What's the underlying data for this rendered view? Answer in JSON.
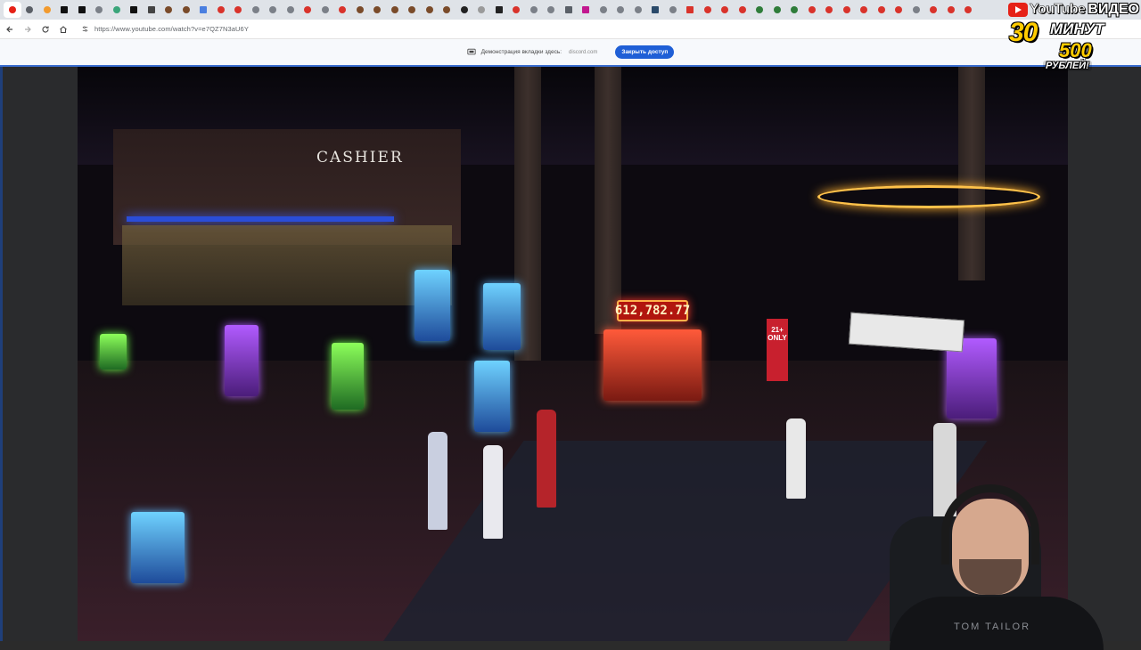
{
  "browser": {
    "tabs": [
      {
        "icon": "youtube-icon",
        "color": "#e62117",
        "active": true
      },
      {
        "icon": "page-icon",
        "color": "#5a5f66"
      },
      {
        "icon": "orange-site-icon",
        "color": "#f29a2e"
      },
      {
        "icon": "x-icon",
        "color": "#111111"
      },
      {
        "icon": "x-icon",
        "color": "#111111"
      },
      {
        "icon": "globe-icon",
        "color": "#7b8088"
      },
      {
        "icon": "green-site-icon",
        "color": "#3aa57a"
      },
      {
        "icon": "x-icon",
        "color": "#111111"
      },
      {
        "icon": "gmail-icon",
        "color": "#444444"
      },
      {
        "icon": "brown-site-icon",
        "color": "#7a4b2a"
      },
      {
        "icon": "brown-site-icon",
        "color": "#7a4b2a"
      },
      {
        "icon": "docs-icon",
        "color": "#4a7fe0"
      },
      {
        "icon": "red-site-icon",
        "color": "#d9332b"
      },
      {
        "icon": "red-site-icon",
        "color": "#d9332b"
      },
      {
        "icon": "google-icon",
        "color": "#7b8088"
      },
      {
        "icon": "globe-icon",
        "color": "#7b8088"
      },
      {
        "icon": "globe-icon",
        "color": "#7b8088"
      },
      {
        "icon": "red-site-icon",
        "color": "#d9332b"
      },
      {
        "icon": "globe-icon",
        "color": "#7b8088"
      },
      {
        "icon": "red-site-icon",
        "color": "#d9332b"
      },
      {
        "icon": "brown-site-icon",
        "color": "#7a4b2a"
      },
      {
        "icon": "brown-site-icon",
        "color": "#7a4b2a"
      },
      {
        "icon": "brown-site-icon",
        "color": "#7a4b2a"
      },
      {
        "icon": "brown-site-icon",
        "color": "#7a4b2a"
      },
      {
        "icon": "brown-site-icon",
        "color": "#7a4b2a"
      },
      {
        "icon": "brown-site-icon",
        "color": "#7a4b2a"
      },
      {
        "icon": "github-icon",
        "color": "#222222"
      },
      {
        "icon": "w-icon",
        "color": "#9a9a9a"
      },
      {
        "icon": "dark-site-icon",
        "color": "#222222"
      },
      {
        "icon": "red-site-icon",
        "color": "#d9332b"
      },
      {
        "icon": "globe-icon",
        "color": "#7b8088"
      },
      {
        "icon": "globe-icon",
        "color": "#7b8088"
      },
      {
        "icon": "gray-site-icon",
        "color": "#5a6068"
      },
      {
        "icon": "magenta-site-icon",
        "color": "#c2188f"
      },
      {
        "icon": "globe-icon",
        "color": "#7b8088"
      },
      {
        "icon": "globe-icon",
        "color": "#7b8088"
      },
      {
        "icon": "globe-icon",
        "color": "#7b8088"
      },
      {
        "icon": "steam-icon",
        "color": "#2a4a6a"
      },
      {
        "icon": "globe-icon",
        "color": "#7b8088"
      },
      {
        "icon": "red-x-icon",
        "color": "#d9332b"
      },
      {
        "icon": "red-site-icon",
        "color": "#d9332b"
      },
      {
        "icon": "red-site-icon",
        "color": "#d9332b"
      },
      {
        "icon": "red-site-icon",
        "color": "#d9332b"
      },
      {
        "icon": "shield-icon",
        "color": "#2f7d3a"
      },
      {
        "icon": "shield-icon",
        "color": "#2f7d3a"
      },
      {
        "icon": "shield-icon",
        "color": "#2f7d3a"
      },
      {
        "icon": "red-site-icon",
        "color": "#d9332b"
      },
      {
        "icon": "red-site-icon",
        "color": "#d9332b"
      },
      {
        "icon": "red-site-icon",
        "color": "#d9332b"
      },
      {
        "icon": "red-site-icon",
        "color": "#d9332b"
      },
      {
        "icon": "red-site-icon",
        "color": "#d9332b"
      },
      {
        "icon": "red-site-icon",
        "color": "#d9332b"
      },
      {
        "icon": "globe-icon",
        "color": "#7b8088"
      },
      {
        "icon": "red-site-icon",
        "color": "#d9332b"
      },
      {
        "icon": "red-site-icon",
        "color": "#d9332b"
      },
      {
        "icon": "red-site-icon",
        "color": "#d9332b"
      }
    ],
    "url": "https://www.youtube.com/watch?v=e7QZ7N3aU6Y"
  },
  "share_bar": {
    "text": "Демонстрация вкладки здесь:",
    "domain": "discord.com",
    "stop_label": "Закрыть доступ"
  },
  "promo": {
    "brand": "YouTube",
    "line1": "ВИДЕО",
    "number": "30",
    "unit": "МИНУТ",
    "price": "500",
    "currency": "РУБЛЕЙ!"
  },
  "video": {
    "cashier_sign": "CASHIER",
    "jackpot_value": "612,782.77",
    "age_sign": "21+ ONLY"
  },
  "webcam": {
    "shirt_text": "TOM TAILOR"
  },
  "colors": {
    "share_accent": "#1f5fd6",
    "youtube_red": "#e62117",
    "promo_yellow": "#ffcc00"
  }
}
